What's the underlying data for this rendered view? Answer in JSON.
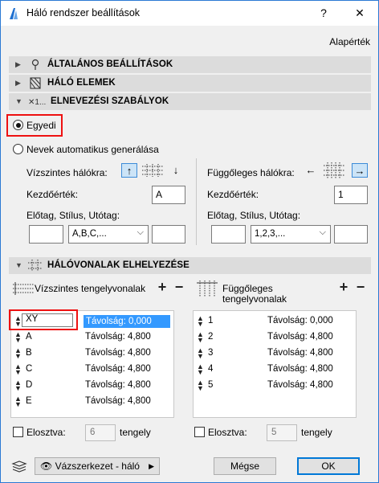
{
  "window": {
    "title": "Háló rendszer beállítások",
    "help": "?",
    "close": "✕"
  },
  "default_link": "Alapérték",
  "sections": {
    "general": "ÁLTALÁNOS BEÁLLÍTÁSOK",
    "elements": "HÁLÓ ELEMEK",
    "naming": "ELNEVEZÉSI SZABÁLYOK",
    "placement": "HÁLÓVONALAK ELHELYEZÉSE"
  },
  "naming": {
    "custom_label": "Egyedi",
    "auto_label": "Nevek automatikus generálása",
    "horizontal": {
      "title": "Vízszintes hálókra:",
      "start_label": "Kezdőérték:",
      "start_value": "A",
      "prefix_label": "Előtag, Stílus, Utótag:",
      "prefix_value": "",
      "style_value": "A,B,C,...",
      "suffix_value": ""
    },
    "vertical": {
      "title": "Függőleges hálókra:",
      "start_label": "Kezdőérték:",
      "start_value": "1",
      "prefix_label": "Előtag, Stílus, Utótag:",
      "prefix_value": "",
      "style_value": "1,2,3,...",
      "suffix_value": ""
    }
  },
  "placement": {
    "horizontal_title": "Vízszintes tengelyvonalak",
    "vertical_title_line1": "Függőleges",
    "vertical_title_line2": "tengelyvonalak",
    "horizontal_rows": [
      {
        "name": "XY",
        "distance": "Távolság: 0,000"
      },
      {
        "name": "A",
        "distance": "Távolság: 4,800"
      },
      {
        "name": "B",
        "distance": "Távolság: 4,800"
      },
      {
        "name": "C",
        "distance": "Távolság: 4,800"
      },
      {
        "name": "D",
        "distance": "Távolság: 4,800"
      },
      {
        "name": "E",
        "distance": "Távolság: 4,800"
      }
    ],
    "vertical_rows": [
      {
        "name": "1",
        "distance": "Távolság: 0,000"
      },
      {
        "name": "2",
        "distance": "Távolság: 4,800"
      },
      {
        "name": "3",
        "distance": "Távolság: 4,800"
      },
      {
        "name": "4",
        "distance": "Távolság: 4,800"
      },
      {
        "name": "5",
        "distance": "Távolság: 4,800"
      }
    ],
    "distribute_label": "Elosztva:",
    "horizontal_count": "6",
    "vertical_count": "5",
    "axis_unit": "tengely"
  },
  "footer": {
    "layer_value": "Vázszerkezet - háló",
    "cancel": "Mégse",
    "ok": "OK"
  },
  "colors": {
    "accent": "#2b79d4",
    "selection": "#3399ff",
    "highlight": "#e11111"
  }
}
